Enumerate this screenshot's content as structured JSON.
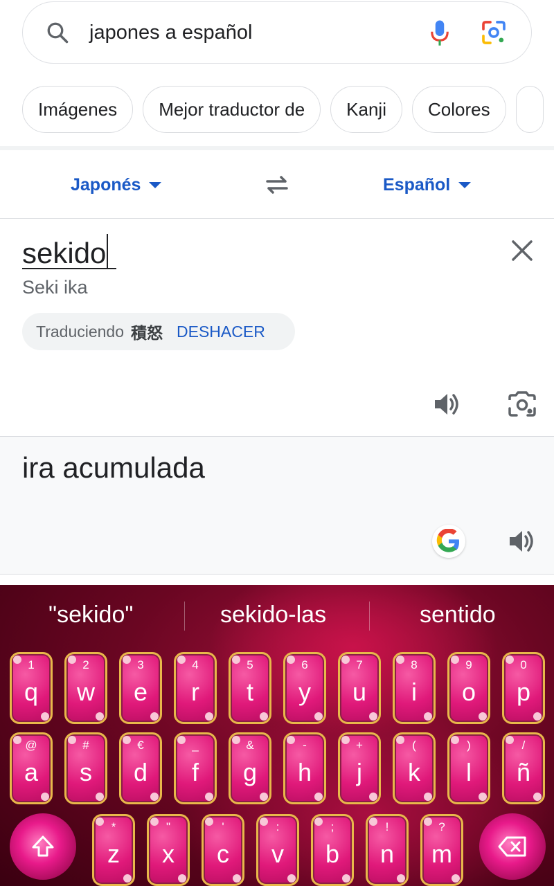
{
  "search": {
    "query": "japones a español"
  },
  "chips": [
    "Imágenes",
    "Mejor traductor de",
    "Kanji",
    "Colores"
  ],
  "translator": {
    "source_lang": "Japonés",
    "target_lang": "Español",
    "source_text": "sekido",
    "transliteration": "Seki ika",
    "translating_label": "Traduciendo",
    "translating_kanji": "積怒",
    "undo_label": "DESHACER",
    "result_text": "ira acumulada"
  },
  "keyboard": {
    "suggestions": [
      "\"sekido\"",
      "sekido-las",
      "sentido"
    ],
    "rows": [
      [
        {
          "l": "q",
          "h": "1"
        },
        {
          "l": "w",
          "h": "2"
        },
        {
          "l": "e",
          "h": "3"
        },
        {
          "l": "r",
          "h": "4"
        },
        {
          "l": "t",
          "h": "5"
        },
        {
          "l": "y",
          "h": "6"
        },
        {
          "l": "u",
          "h": "7"
        },
        {
          "l": "i",
          "h": "8"
        },
        {
          "l": "o",
          "h": "9"
        },
        {
          "l": "p",
          "h": "0"
        }
      ],
      [
        {
          "l": "a",
          "h": "@"
        },
        {
          "l": "s",
          "h": "#"
        },
        {
          "l": "d",
          "h": "€"
        },
        {
          "l": "f",
          "h": "_"
        },
        {
          "l": "g",
          "h": "&"
        },
        {
          "l": "h",
          "h": "-"
        },
        {
          "l": "j",
          "h": "+"
        },
        {
          "l": "k",
          "h": "("
        },
        {
          "l": "l",
          "h": ")"
        },
        {
          "l": "ñ",
          "h": "/"
        }
      ],
      [
        {
          "l": "z",
          "h": "*"
        },
        {
          "l": "x",
          "h": "\""
        },
        {
          "l": "c",
          "h": "'"
        },
        {
          "l": "v",
          "h": ":"
        },
        {
          "l": "b",
          "h": ";"
        },
        {
          "l": "n",
          "h": "!"
        },
        {
          "l": "m",
          "h": "?"
        }
      ]
    ]
  },
  "colors": {
    "accent_blue": "#1a59c6",
    "key_pink": "#e0197a",
    "key_border_gold": "#e8b84a"
  }
}
